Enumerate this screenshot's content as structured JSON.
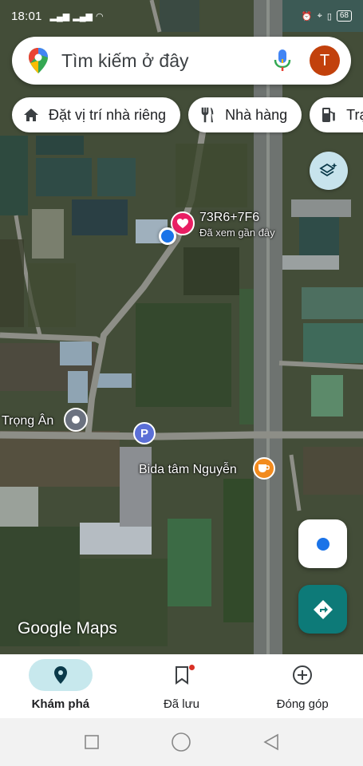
{
  "status_bar": {
    "time": "18:01",
    "battery": "68"
  },
  "search": {
    "placeholder": "Tìm kiếm ở đây",
    "avatar_letter": "T"
  },
  "chips": [
    {
      "icon": "home-icon",
      "label": "Đặt vị trí nhà riêng"
    },
    {
      "icon": "restaurant-icon",
      "label": "Nhà hàng"
    },
    {
      "icon": "gas-station-icon",
      "label": "Trạm xăng"
    }
  ],
  "map": {
    "place_code": "73R6+7F6",
    "place_sub": "Đã xem gần đây",
    "poi_trong_an": "Trọng Ân",
    "poi_bida": "Bida tâm Nguyễn",
    "parking_letter": "P",
    "watermark": "Google Maps"
  },
  "bottom_nav": [
    {
      "icon": "explore-pin-icon",
      "label": "Khám phá",
      "active": true
    },
    {
      "icon": "bookmark-icon",
      "label": "Đã lưu",
      "active": false
    },
    {
      "icon": "add-circle-icon",
      "label": "Đóng góp",
      "active": false
    }
  ],
  "colors": {
    "accent": "#1a73e8",
    "active_nav_bg": "#c7e8ed",
    "directions_button": "#0d7a78",
    "favorite_pin": "#e91e63",
    "avatar": "#c2410c"
  }
}
